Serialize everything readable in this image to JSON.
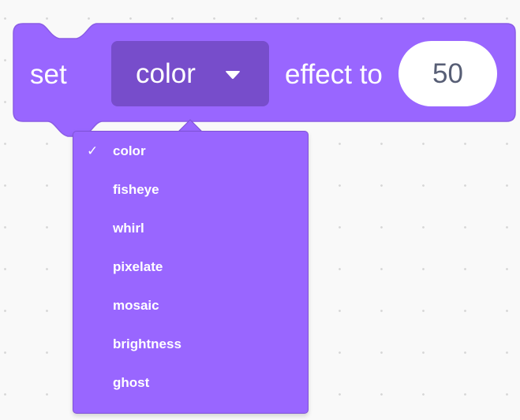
{
  "block": {
    "prefix_text": "set",
    "suffix_text": "effect to",
    "selected_effect": "color",
    "value": "50",
    "color": "#9966ff",
    "dropdown_color": "#774dcb"
  },
  "dropdown_menu": {
    "selected_index": 0,
    "check_glyph": "✓",
    "items": [
      {
        "label": "color"
      },
      {
        "label": "fisheye"
      },
      {
        "label": "whirl"
      },
      {
        "label": "pixelate"
      },
      {
        "label": "mosaic"
      },
      {
        "label": "brightness"
      },
      {
        "label": "ghost"
      }
    ]
  }
}
